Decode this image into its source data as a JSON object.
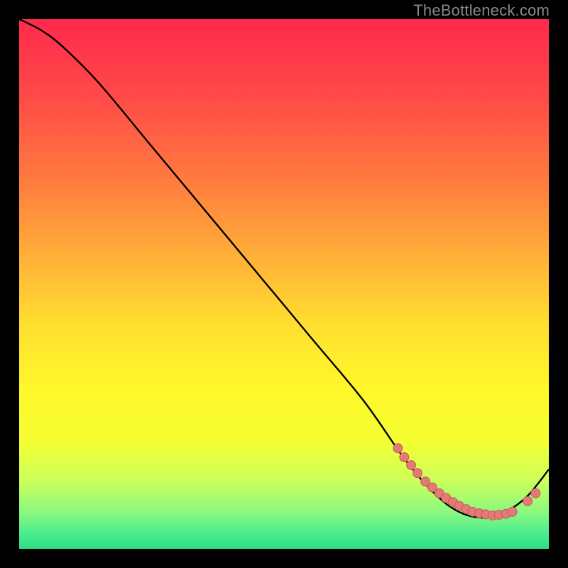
{
  "watermark": "TheBottleneck.com",
  "colors": {
    "page_bg": "#000000",
    "border": "#000000",
    "curve": "#000000",
    "dot_fill": "#e37a77",
    "dot_stroke": "#c45a57",
    "watermark": "#888888",
    "gradient_stops": [
      {
        "offset": 0.0,
        "color": "#ff2a4d"
      },
      {
        "offset": 0.15,
        "color": "#ff4b48"
      },
      {
        "offset": 0.3,
        "color": "#ff7a3f"
      },
      {
        "offset": 0.45,
        "color": "#ffb038"
      },
      {
        "offset": 0.58,
        "color": "#ffe02f"
      },
      {
        "offset": 0.7,
        "color": "#fff82a"
      },
      {
        "offset": 0.8,
        "color": "#f4ff33"
      },
      {
        "offset": 0.87,
        "color": "#ccff5a"
      },
      {
        "offset": 0.93,
        "color": "#8cf97e"
      },
      {
        "offset": 0.97,
        "color": "#4eed8e"
      },
      {
        "offset": 1.0,
        "color": "#2ddf85"
      }
    ]
  },
  "chart_data": {
    "type": "line",
    "title": "",
    "xlabel": "",
    "ylabel": "",
    "xlim": [
      0,
      100
    ],
    "ylim": [
      0,
      100
    ],
    "series": [
      {
        "name": "bottleneck-curve",
        "x": [
          0,
          4,
          8,
          15,
          25,
          35,
          45,
          55,
          65,
          72,
          76,
          80,
          83,
          86,
          89,
          92,
          96,
          100
        ],
        "y": [
          100,
          98,
          95,
          88,
          76,
          64,
          52,
          40,
          28,
          18,
          13,
          9,
          7,
          6,
          6,
          7,
          10,
          15
        ]
      }
    ],
    "highlight_points": {
      "name": "threshold-dots",
      "x": [
        71.5,
        72.7,
        74.0,
        75.2,
        76.7,
        78.0,
        79.3,
        80.6,
        81.9,
        83.1,
        84.4,
        85.6,
        86.9,
        88.1,
        89.4,
        90.6,
        91.9,
        93.1,
        96.0,
        97.5
      ],
      "y": [
        19.0,
        17.3,
        15.8,
        14.3,
        12.7,
        11.6,
        10.5,
        9.6,
        8.8,
        8.1,
        7.5,
        7.0,
        6.7,
        6.5,
        6.3,
        6.4,
        6.6,
        7.0,
        9.0,
        10.5
      ]
    }
  }
}
